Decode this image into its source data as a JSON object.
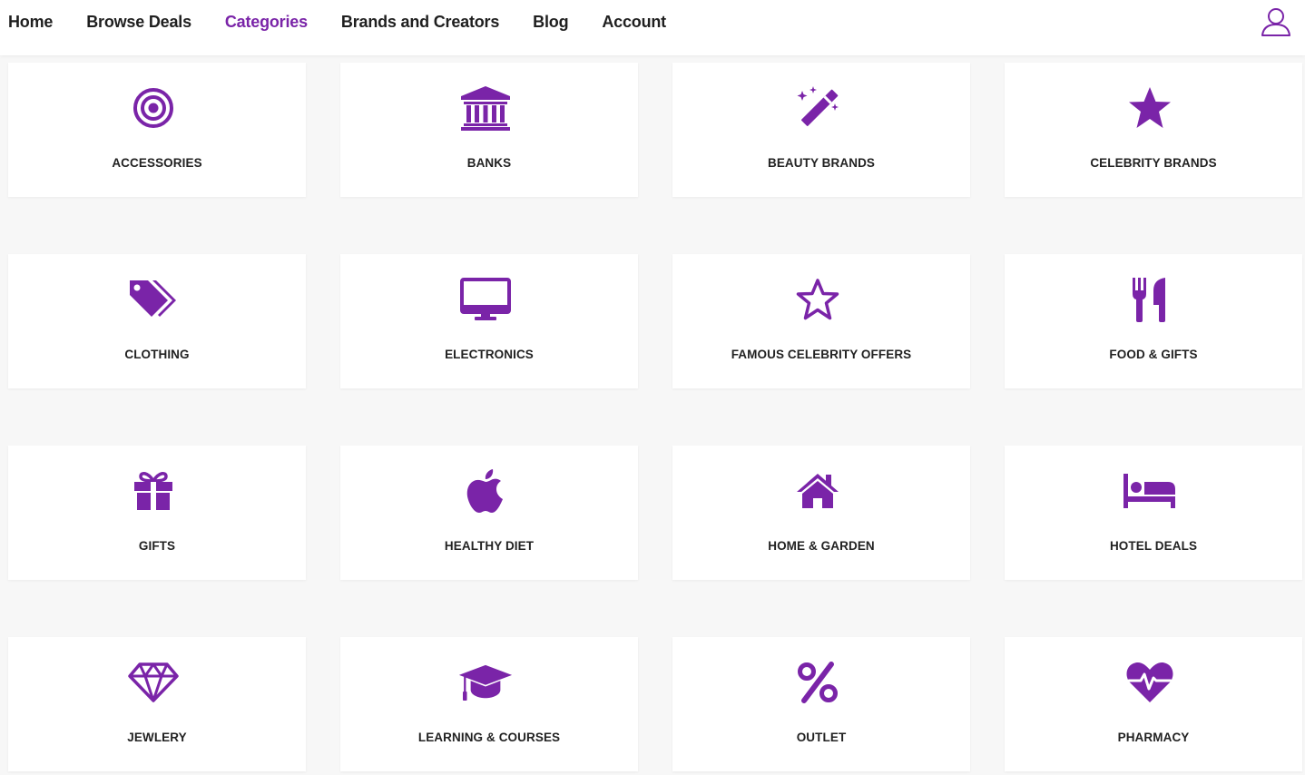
{
  "nav": {
    "items": [
      {
        "label": "Home"
      },
      {
        "label": "Browse Deals"
      },
      {
        "label": "Categories"
      },
      {
        "label": "Brands and Creators"
      },
      {
        "label": "Blog"
      },
      {
        "label": "Account"
      }
    ],
    "active_index": 2,
    "user_icon": "user-icon"
  },
  "colors": {
    "accent": "#7a24a8",
    "text": "#222222",
    "background": "#f7f7f7",
    "card": "#ffffff"
  },
  "categories": [
    {
      "label": "ACCESSORIES",
      "icon": "target-icon"
    },
    {
      "label": "BANKS",
      "icon": "bank-icon"
    },
    {
      "label": "BEAUTY BRANDS",
      "icon": "magic-wand-icon"
    },
    {
      "label": "CELEBRITY BRANDS",
      "icon": "star-filled-icon"
    },
    {
      "label": "CLOTHING",
      "icon": "tags-icon"
    },
    {
      "label": "ELECTRONICS",
      "icon": "desktop-icon"
    },
    {
      "label": "FAMOUS CELEBRITY OFFERS",
      "icon": "star-outline-icon"
    },
    {
      "label": "FOOD & GIFTS",
      "icon": "utensils-icon"
    },
    {
      "label": "GIFTS",
      "icon": "gift-icon"
    },
    {
      "label": "HEALTHY DIET",
      "icon": "apple-icon"
    },
    {
      "label": "HOME & GARDEN",
      "icon": "home-icon"
    },
    {
      "label": "HOTEL DEALS",
      "icon": "bed-icon"
    },
    {
      "label": "JEWLERY",
      "icon": "diamond-icon"
    },
    {
      "label": "LEARNING & COURSES",
      "icon": "graduation-cap-icon"
    },
    {
      "label": "OUTLET",
      "icon": "percent-icon"
    },
    {
      "label": "PHARMACY",
      "icon": "heartbeat-icon"
    }
  ]
}
